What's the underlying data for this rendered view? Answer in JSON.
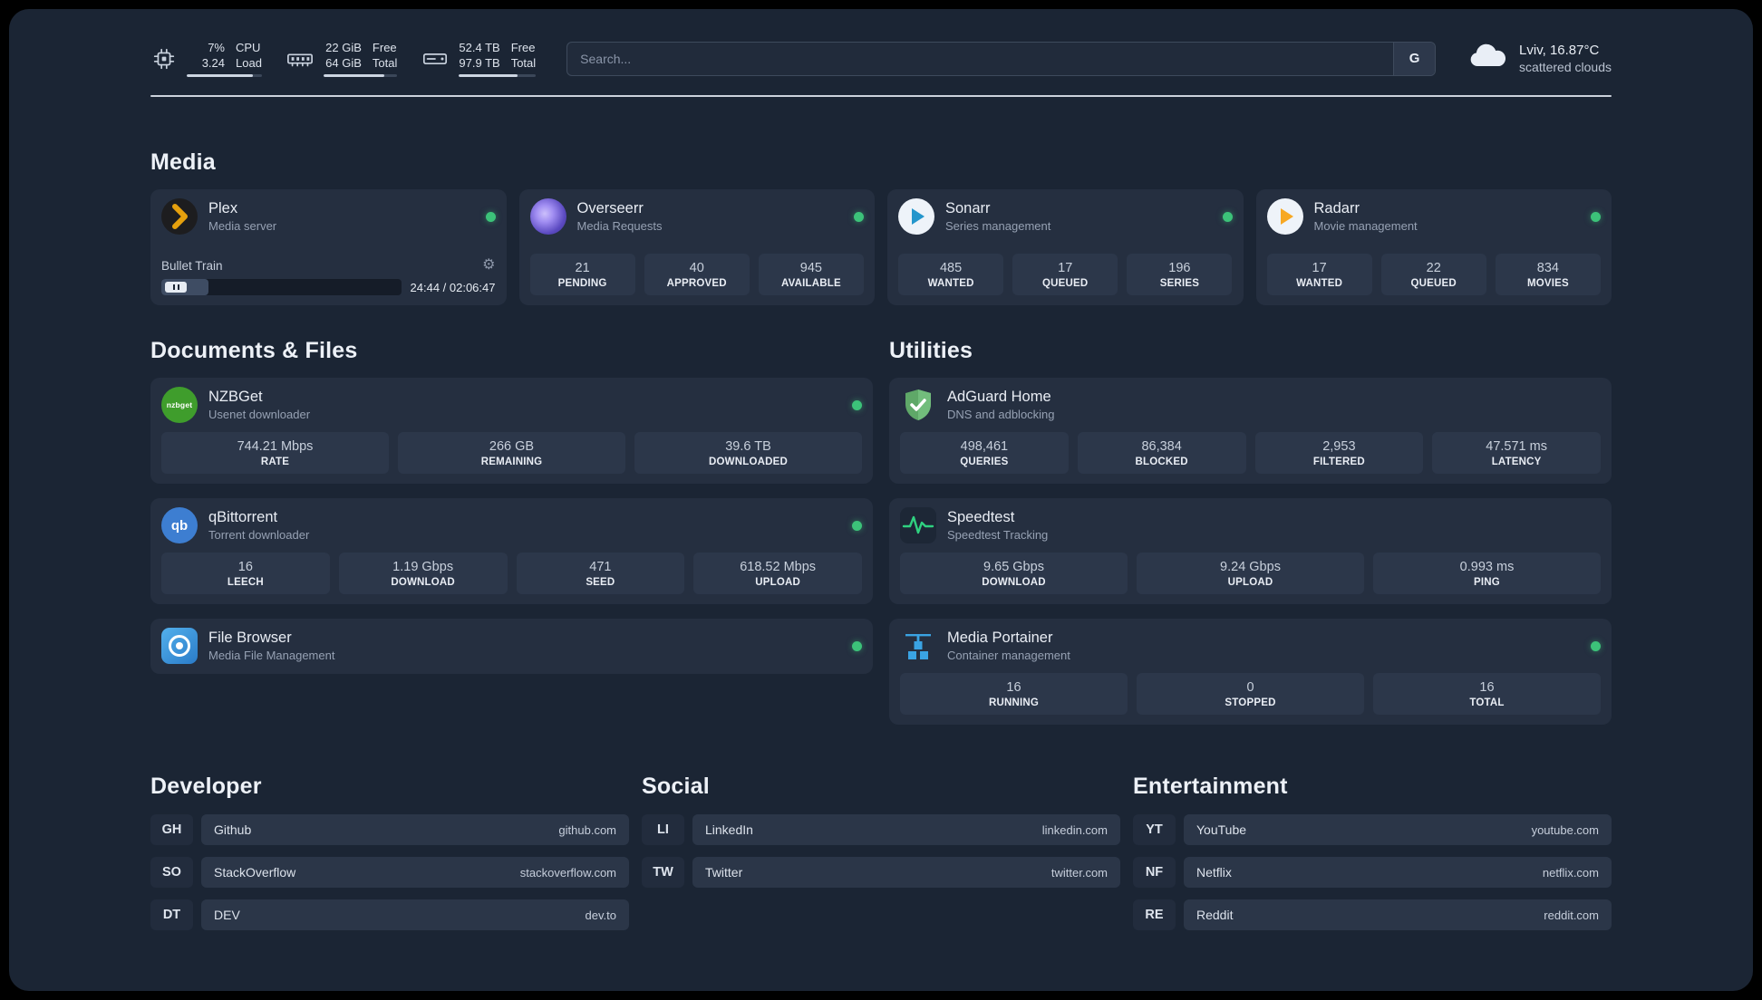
{
  "topbar": {
    "cpu": {
      "value_top": "7%",
      "value_bottom": "3.24",
      "label_top": "CPU",
      "label_bottom": "Load",
      "bar_style": "width:88%"
    },
    "memory": {
      "value_top": "22 GiB",
      "value_bottom": "64 GiB",
      "label_top": "Free",
      "label_bottom": "Total",
      "bar_style": "width:82%"
    },
    "disk": {
      "value_top": "52.4 TB",
      "value_bottom": "97.9 TB",
      "label_top": "Free",
      "label_bottom": "Total",
      "bar_style": "width:76%"
    },
    "search": {
      "placeholder": "Search...",
      "button_label": "G"
    },
    "weather": {
      "location": "Lviv, 16.87°C",
      "condition": "scattered clouds"
    }
  },
  "media": {
    "title": "Media",
    "plex": {
      "title": "Plex",
      "subtitle": "Media server",
      "now_playing": "Bullet Train",
      "time": "24:44 / 02:06:47",
      "progress_style": "width:19.5%"
    },
    "overseerr": {
      "title": "Overseerr",
      "subtitle": "Media Requests",
      "stats": [
        {
          "value": "21",
          "label": "PENDING"
        },
        {
          "value": "40",
          "label": "APPROVED"
        },
        {
          "value": "945",
          "label": "AVAILABLE"
        }
      ]
    },
    "sonarr": {
      "title": "Sonarr",
      "subtitle": "Series management",
      "stats": [
        {
          "value": "485",
          "label": "WANTED"
        },
        {
          "value": "17",
          "label": "QUEUED"
        },
        {
          "value": "196",
          "label": "SERIES"
        }
      ]
    },
    "radarr": {
      "title": "Radarr",
      "subtitle": "Movie management",
      "stats": [
        {
          "value": "17",
          "label": "WANTED"
        },
        {
          "value": "22",
          "label": "QUEUED"
        },
        {
          "value": "834",
          "label": "MOVIES"
        }
      ]
    }
  },
  "docs": {
    "title": "Documents & Files",
    "nzbget": {
      "title": "NZBGet",
      "subtitle": "Usenet downloader",
      "stats": [
        {
          "value": "744.21 Mbps",
          "label": "RATE"
        },
        {
          "value": "266 GB",
          "label": "REMAINING"
        },
        {
          "value": "39.6 TB",
          "label": "DOWNLOADED"
        }
      ]
    },
    "qbittorrent": {
      "title": "qBittorrent",
      "subtitle": "Torrent downloader",
      "stats": [
        {
          "value": "16",
          "label": "LEECH"
        },
        {
          "value": "1.19 Gbps",
          "label": "DOWNLOAD"
        },
        {
          "value": "471",
          "label": "SEED"
        },
        {
          "value": "618.52 Mbps",
          "label": "UPLOAD"
        }
      ]
    },
    "filebrowser": {
      "title": "File Browser",
      "subtitle": "Media File Management"
    }
  },
  "utilities": {
    "title": "Utilities",
    "adguard": {
      "title": "AdGuard Home",
      "subtitle": "DNS and adblocking",
      "stats": [
        {
          "value": "498,461",
          "label": "QUERIES"
        },
        {
          "value": "86,384",
          "label": "BLOCKED"
        },
        {
          "value": "2,953",
          "label": "FILTERED"
        },
        {
          "value": "47.571 ms",
          "label": "LATENCY"
        }
      ]
    },
    "speedtest": {
      "title": "Speedtest",
      "subtitle": "Speedtest Tracking",
      "stats": [
        {
          "value": "9.65 Gbps",
          "label": "DOWNLOAD"
        },
        {
          "value": "9.24 Gbps",
          "label": "UPLOAD"
        },
        {
          "value": "0.993 ms",
          "label": "PING"
        }
      ]
    },
    "portainer": {
      "title": "Media Portainer",
      "subtitle": "Container management",
      "stats": [
        {
          "value": "16",
          "label": "RUNNING"
        },
        {
          "value": "0",
          "label": "STOPPED"
        },
        {
          "value": "16",
          "label": "TOTAL"
        }
      ]
    }
  },
  "bookmarks": {
    "developer": {
      "title": "Developer",
      "items": [
        {
          "abbr": "GH",
          "name": "Github",
          "url": "github.com"
        },
        {
          "abbr": "SO",
          "name": "StackOverflow",
          "url": "stackoverflow.com"
        },
        {
          "abbr": "DT",
          "name": "DEV",
          "url": "dev.to"
        }
      ]
    },
    "social": {
      "title": "Social",
      "items": [
        {
          "abbr": "LI",
          "name": "LinkedIn",
          "url": "linkedin.com"
        },
        {
          "abbr": "TW",
          "name": "Twitter",
          "url": "twitter.com"
        }
      ]
    },
    "entertainment": {
      "title": "Entertainment",
      "items": [
        {
          "abbr": "YT",
          "name": "YouTube",
          "url": "youtube.com"
        },
        {
          "abbr": "NF",
          "name": "Netflix",
          "url": "netflix.com"
        },
        {
          "abbr": "RE",
          "name": "Reddit",
          "url": "reddit.com"
        }
      ]
    }
  }
}
